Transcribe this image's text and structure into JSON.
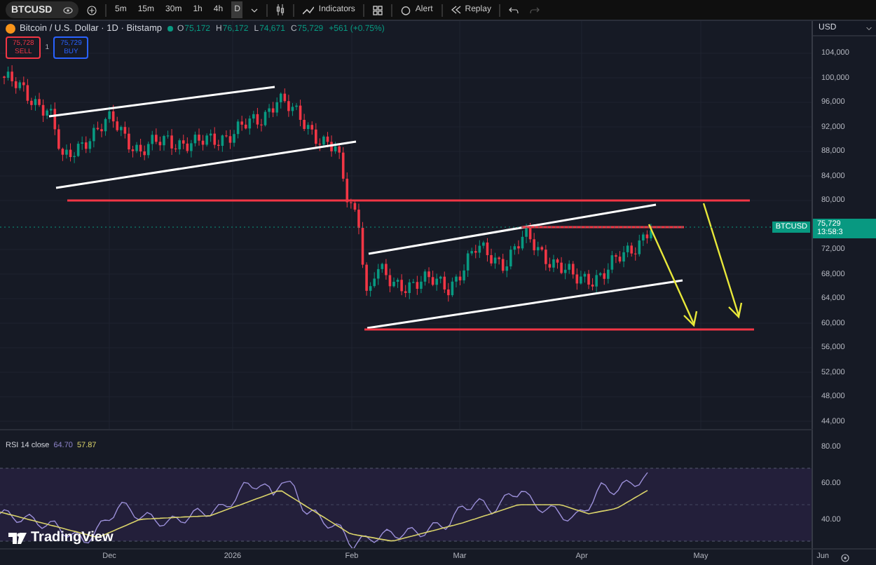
{
  "toolbar": {
    "symbol": "BTCUSD",
    "intervals": [
      {
        "label": "5m",
        "selected": false
      },
      {
        "label": "15m",
        "selected": false
      },
      {
        "label": "30m",
        "selected": false
      },
      {
        "label": "1h",
        "selected": false
      },
      {
        "label": "4h",
        "selected": false
      },
      {
        "label": "D",
        "selected": true
      }
    ],
    "buttons": [
      {
        "kind": "indicators",
        "label": "Indicators"
      },
      {
        "kind": "layout"
      },
      {
        "kind": "alert",
        "label": "Alert"
      },
      {
        "kind": "replay",
        "label": "Replay"
      }
    ]
  },
  "legend": {
    "title": "Bitcoin / U.S. Dollar · 1D · Bitstamp",
    "ohlc": [
      {
        "label": "O",
        "value": "75,172"
      },
      {
        "label": "H",
        "value": "76,172"
      },
      {
        "label": "L",
        "value": "74,671"
      },
      {
        "label": "C",
        "value": "75,729"
      }
    ],
    "change": "+561 (+0.75%)"
  },
  "trade": {
    "sell": {
      "price": "75,728",
      "label": "SELL"
    },
    "spread": "1",
    "buy": {
      "price": "75,729",
      "label": "BUY"
    }
  },
  "price_axis": {
    "currency": "USD",
    "ticks": [
      "104,000",
      "100,000",
      "96,000",
      "92,000",
      "88,000",
      "84,000",
      "80,000",
      "72,000",
      "68,000",
      "64,000",
      "60,000",
      "56,000",
      "52,000",
      "48,000",
      "44,000"
    ],
    "current": {
      "symbol": "BTCUSD",
      "price": "75,729",
      "countdown": "13:58:3"
    }
  },
  "rsi": {
    "title": "RSI 14 close",
    "value": "64.70",
    "ma_value": "57.87",
    "ticks": [
      "80.00",
      "60.00",
      "40.00"
    ]
  },
  "time_axis": [
    "Dec",
    "2026",
    "Feb",
    "Mar",
    "Apr",
    "May",
    "Jun"
  ],
  "branding": "TradingView"
}
